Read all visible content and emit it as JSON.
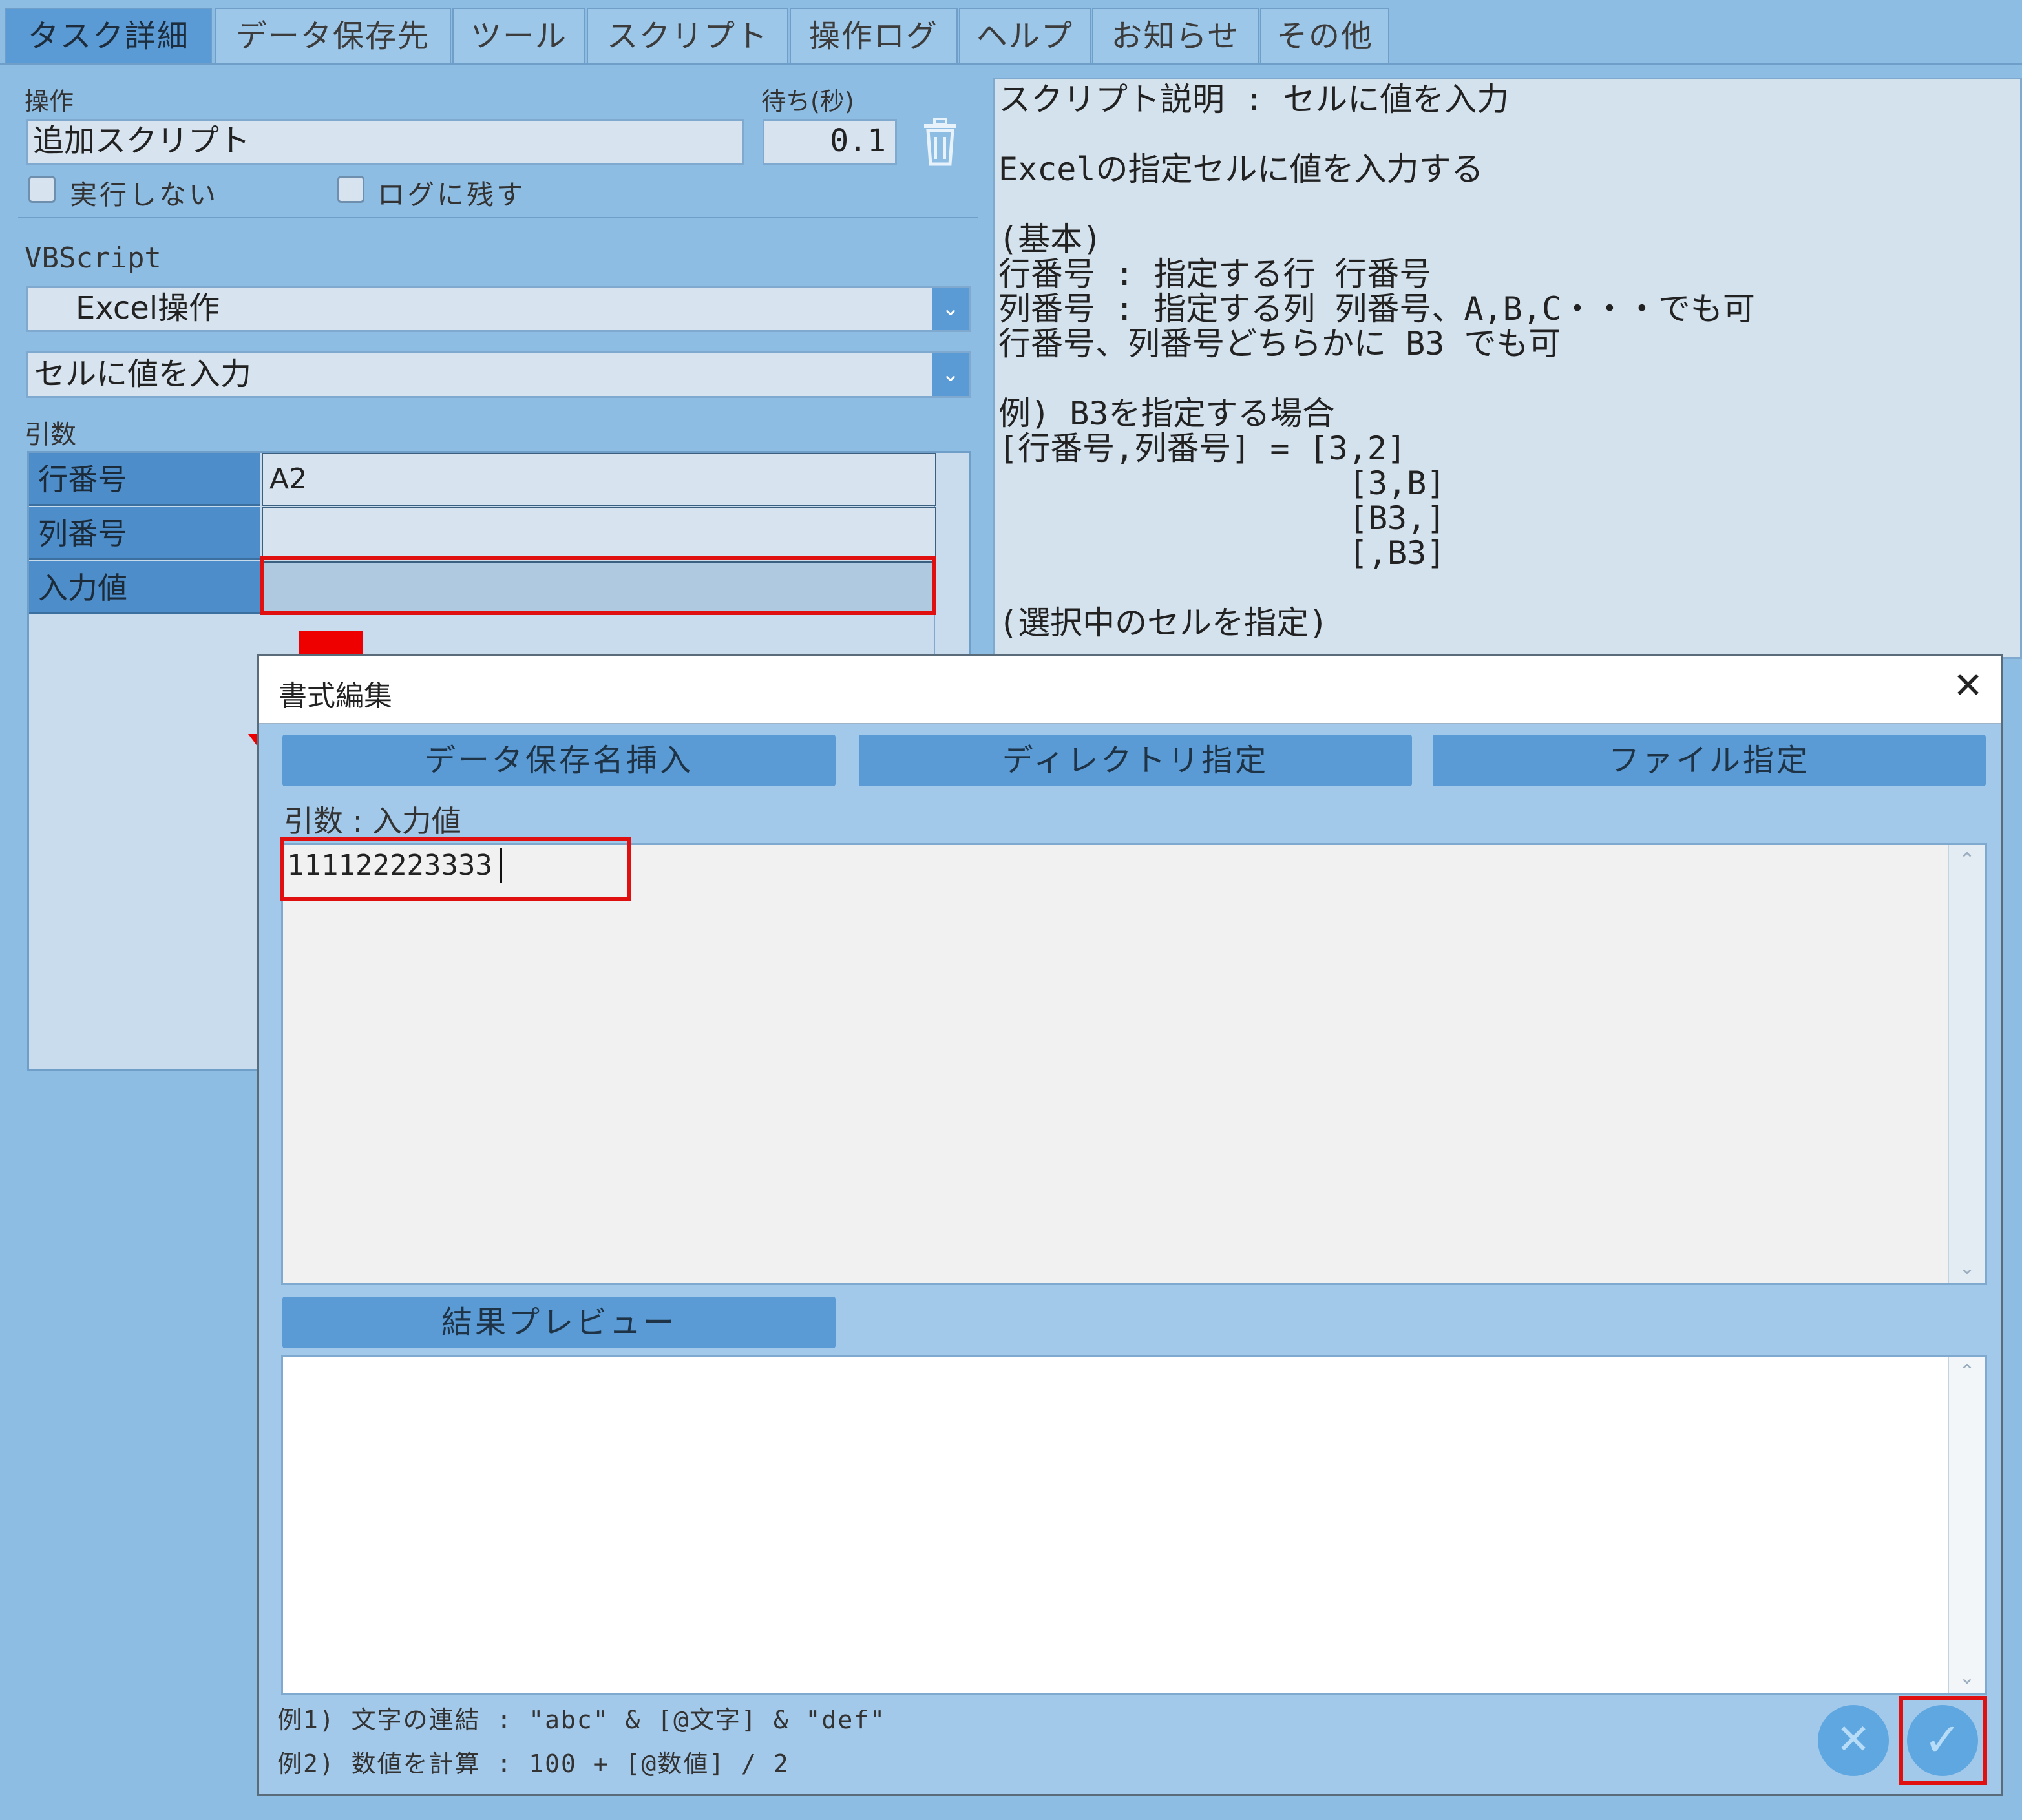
{
  "tabs": [
    {
      "label": "タスク詳細",
      "active": true
    },
    {
      "label": "データ保存先"
    },
    {
      "label": "ツール"
    },
    {
      "label": "スクリプト"
    },
    {
      "label": "操作ログ"
    },
    {
      "label": "ヘルプ"
    },
    {
      "label": "お知らせ"
    },
    {
      "label": "その他"
    }
  ],
  "operation": {
    "label": "操作",
    "value": "追加スクリプト",
    "wait_label": "待ち(秒)",
    "wait_value": "0.1",
    "no_execute_label": "実行しない",
    "keep_log_label": "ログに残す"
  },
  "script": {
    "type_label": "VBScript",
    "category": "Excel操作",
    "action": "セルに値を入力"
  },
  "args": {
    "label": "引数",
    "rows": [
      {
        "name": "行番号",
        "value": "A2"
      },
      {
        "name": "列番号",
        "value": ""
      },
      {
        "name": "入力値",
        "value": ""
      }
    ]
  },
  "description": {
    "text": "スクリプト説明 : セルに値を入力\n\nExcelの指定セルに値を入力する\n\n(基本)\n行番号 : 指定する行 行番号\n列番号 : 指定する列 列番号、A,B,C・・・でも可\n行番号、列番号どちらかに B3 でも可\n\n例) B3を指定する場合\n[行番号,列番号] = [3,2]\n                  [3,B]\n                  [B3,]\n                  [,B3]\n\n(選択中のセルを指定)"
  },
  "dialog": {
    "title": "書式編集",
    "close_glyph": "✕",
    "buttons": {
      "insert_data": "データ保存名挿入",
      "directory": "ディレクトリ指定",
      "file": "ファイル指定",
      "preview": "結果プレビュー"
    },
    "arg_label": "引数 : 入力値",
    "input_value": "111122223333",
    "preview_value": "",
    "example1": "例1) 文字の連結 : \"abc\" & [@文字] & \"def\"",
    "example2": "例2) 数値を計算 : 100 + [@数値] / 2",
    "cancel_glyph": "✕",
    "ok_glyph": "✓"
  },
  "colors": {
    "accent": "#5a9bd5",
    "background": "#8ebde4",
    "highlight": "#e01010"
  }
}
